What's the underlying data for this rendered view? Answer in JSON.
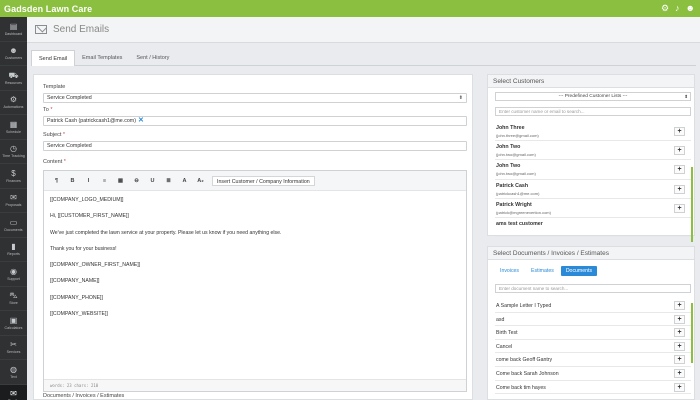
{
  "app": {
    "brand": "Gadsden Lawn Care"
  },
  "topbar_icons": [
    "gear-icon",
    "bell-icon",
    "user-icon"
  ],
  "sidebar": {
    "items": [
      {
        "label": "Dashboard",
        "icon": "▤",
        "icon_name": "dashboard-icon"
      },
      {
        "label": "Customers",
        "icon": "☻",
        "icon_name": "customers-icon"
      },
      {
        "label": "Resources",
        "icon": "⛟",
        "icon_name": "resources-icon"
      },
      {
        "label": "Automations",
        "icon": "⚙",
        "icon_name": "automations-icon"
      },
      {
        "label": "Schedule",
        "icon": "▦",
        "icon_name": "schedule-icon"
      },
      {
        "label": "Time Tracking",
        "icon": "◷",
        "icon_name": "clock-icon"
      },
      {
        "label": "Finances",
        "icon": "$",
        "icon_name": "dollar-icon"
      },
      {
        "label": "Proposals",
        "icon": "✉",
        "icon_name": "proposal-icon"
      },
      {
        "label": "Documents",
        "icon": "▭",
        "icon_name": "documents-icon"
      },
      {
        "label": "Reports",
        "icon": "▮",
        "icon_name": "reports-icon"
      },
      {
        "label": "Support",
        "icon": "◉",
        "icon_name": "support-icon"
      },
      {
        "label": "Store",
        "icon": "⛍",
        "icon_name": "store-icon"
      },
      {
        "label": "Calculators",
        "icon": "▣",
        "icon_name": "calculator-icon"
      },
      {
        "label": "Services",
        "icon": "✂",
        "icon_name": "services-icon"
      },
      {
        "label": "Text",
        "icon": "◍",
        "icon_name": "text-icon"
      },
      {
        "label": "Emails",
        "icon": "✉",
        "icon_name": "emails-icon",
        "active": true
      }
    ]
  },
  "header": {
    "title": "Send Emails"
  },
  "tabs": [
    {
      "label": "Send Email",
      "active": true
    },
    {
      "label": "Email Templates"
    },
    {
      "label": "Sent / History"
    }
  ],
  "form": {
    "template_label": "Template",
    "template_value": "Service Completed",
    "to_label": "To",
    "to_value": "Patrick Cash (patrickcash1@me.com)",
    "subject_label": "Subject",
    "subject_value": "Service Completed",
    "content_label": "Content",
    "required_mark": "*",
    "docs_label": "Documents / Invoices / Estimates"
  },
  "toolbar": {
    "buttons": [
      "¶",
      "B",
      "I",
      "≡",
      "▦",
      "⊖",
      "U",
      "≣",
      "A",
      "A₂"
    ],
    "insert_label": "Insert Customer / Company Information"
  },
  "editor": {
    "lines": [
      "[[COMPANY_LOGO_MEDIUM]]",
      "Hi, [[CUSTOMER_FIRST_NAME]]",
      "We've just completed the lawn service at your property. Please let us know if you need anything else.",
      "Thank you for your business!",
      "[[COMPANY_OWNER_FIRST_NAME]]",
      "[[COMPANY_NAME]]",
      "[[COMPANY_PHONE]]",
      "[[COMPANY_WEBSITE]]"
    ],
    "footer": "words: 23   chars: 210"
  },
  "select_customers": {
    "title": "Select Customers",
    "list_select": "--- Predefined Customer Lists ---",
    "search_placeholder": "Enter customer name or email to search...",
    "customers": [
      {
        "name": "John Three",
        "email": "(john.three@gmail.com)"
      },
      {
        "name": "John Two",
        "email": "(john.two@gmail.com)"
      },
      {
        "name": "John Two",
        "email": "(john.two@gmail.com)"
      },
      {
        "name": "Patrick Cash",
        "email": "(patrickcash1@me.com)"
      },
      {
        "name": "Patrick Wright",
        "email": "(patrick@mgreenexertion.com)"
      },
      {
        "name": "ams test customer",
        "email": ""
      }
    ]
  },
  "select_documents": {
    "title": "Select Documents / Invoices / Estimates",
    "seg": [
      {
        "label": "Invoices"
      },
      {
        "label": "Estimates"
      },
      {
        "label": "Documents",
        "active": true
      }
    ],
    "search_placeholder": "Enter document name to search...",
    "documents": [
      "A Sample Letter I Typed",
      "asd",
      "Birth Test",
      "Cancel",
      "come back Geoff Gantry",
      "Come back Sarah Johnson",
      "Come back tim hayes"
    ]
  },
  "add_label": "+",
  "colors": {
    "accent": "#8bbf3f",
    "link": "#2a8ad8",
    "sidebar": "#2f3133"
  }
}
